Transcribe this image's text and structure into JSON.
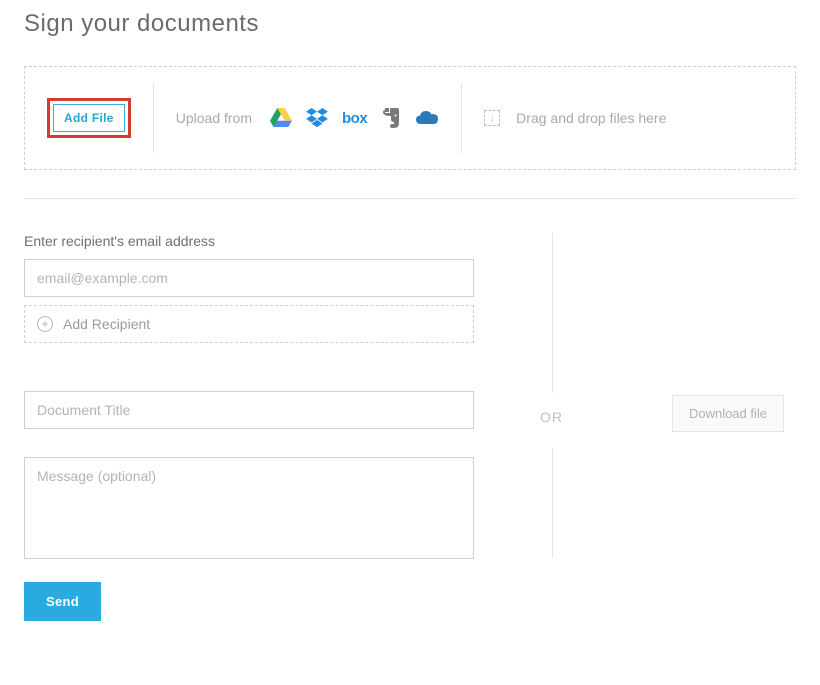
{
  "page": {
    "title": "Sign your documents"
  },
  "upload": {
    "add_file_label": "Add File",
    "upload_from_label": "Upload from",
    "icons": {
      "gdrive": "google-drive-icon",
      "dropbox": "dropbox-icon",
      "box": "box-icon",
      "evernote": "evernote-icon",
      "onedrive": "onedrive-icon"
    },
    "drag_drop_label": "Drag and drop files here"
  },
  "form": {
    "recipient_label": "Enter recipient's email address",
    "email_placeholder": "email@example.com",
    "add_recipient_label": "Add Recipient",
    "doc_title_placeholder": "Document Title",
    "message_placeholder": "Message (optional)",
    "send_label": "Send"
  },
  "right": {
    "or_label": "OR",
    "download_label": "Download file"
  },
  "colors": {
    "highlight_red": "#d63b2f",
    "primary_blue": "#29abe2",
    "text_muted": "#a9a9a9"
  }
}
